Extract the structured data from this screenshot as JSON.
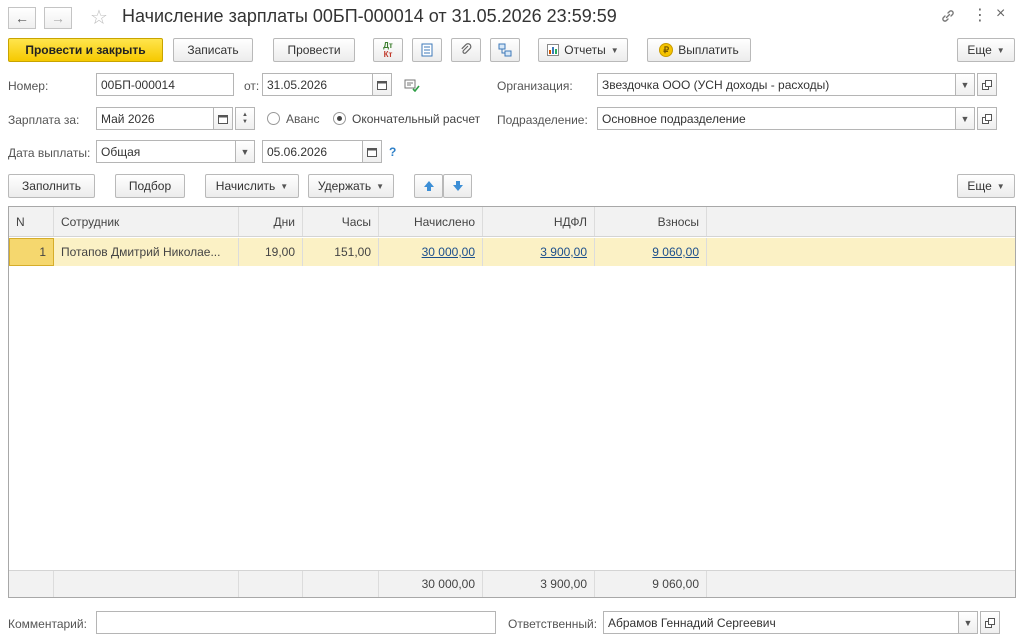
{
  "window": {
    "title": "Начисление зарплаты 00БП-000014 от 31.05.2026 23:59:59"
  },
  "toolbar": {
    "post_and_close": "Провести и закрыть",
    "save": "Записать",
    "post": "Провести",
    "dt_kt_top": "Дт",
    "dt_kt_bottom": "Кт",
    "reports": "Отчеты",
    "pay": "Выплатить",
    "more": "Еще"
  },
  "form": {
    "number_label": "Номер:",
    "number_value": "00БП-000014",
    "date_label": "от:",
    "date_value": "31.05.2026",
    "org_label": "Организация:",
    "org_value": "Звездочка ООО (УСН доходы - расходы)",
    "salary_for_label": "Зарплата за:",
    "salary_for_value": "Май 2026",
    "advance_label": "Аванс",
    "final_label": "Окончательный расчет",
    "dept_label": "Подразделение:",
    "dept_value": "Основное подразделение",
    "pay_date_label": "Дата выплаты:",
    "pay_date_type": "Общая",
    "pay_date_value": "05.06.2026",
    "help": "?"
  },
  "table_toolbar": {
    "fill": "Заполнить",
    "select": "Подбор",
    "accrue": "Начислить",
    "deduct": "Удержать",
    "more": "Еще"
  },
  "table": {
    "columns": [
      "N",
      "Сотрудник",
      "Дни",
      "Часы",
      "Начислено",
      "НДФЛ",
      "Взносы"
    ],
    "rows": [
      {
        "n": "1",
        "employee": "Потапов Дмитрий Николае...",
        "days": "19,00",
        "hours": "151,00",
        "accrued": "30 000,00",
        "ndfl": "3 900,00",
        "contributions": "9 060,00"
      }
    ],
    "totals": {
      "accrued": "30 000,00",
      "ndfl": "3 900,00",
      "contributions": "9 060,00"
    }
  },
  "footer": {
    "comment_label": "Комментарий:",
    "comment_value": "",
    "responsible_label": "Ответственный:",
    "responsible_value": "Абрамов Геннадий Сергеевич"
  },
  "colors": {
    "primary_button": "#f6c900",
    "selected_row": "#fbf1c5",
    "link": "#1c4f8c",
    "arrow_blue": "#3d8fd6"
  }
}
